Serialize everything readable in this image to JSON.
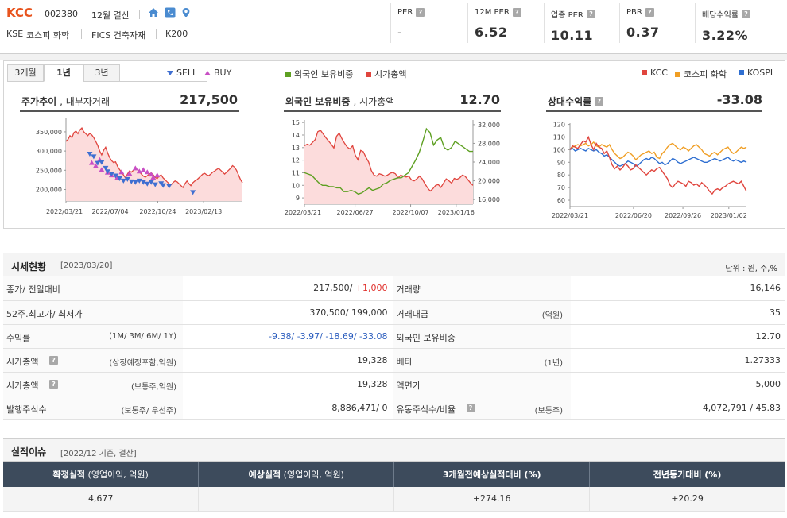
{
  "header": {
    "name": "KCC",
    "code": "002380",
    "settlement": "12월 결산",
    "market": "KSE",
    "sector_kospi": "코스피 화학",
    "sector_fics": "FICS 건축자재",
    "index": "K200",
    "metrics": [
      {
        "label": "PER",
        "value": "-"
      },
      {
        "label": "12M PER",
        "value": "6.52"
      },
      {
        "label": "업종 PER",
        "value": "10.11"
      },
      {
        "label": "PBR",
        "value": "0.37"
      },
      {
        "label": "배당수익률",
        "value": "3.22%"
      }
    ]
  },
  "charts": {
    "tabs": [
      "3개월",
      "1년",
      "3년"
    ],
    "active_tab": "1년",
    "legend_trades": [
      "SELL",
      "BUY"
    ],
    "legend_foreign": [
      "외국인 보유비중",
      "시가총액"
    ],
    "legend_relative": [
      "KCC",
      "코스피 화학",
      "KOSPI"
    ],
    "price": {
      "title_bold": "주가추이",
      "title_rest": ", 내부자거래",
      "value": "217,500"
    },
    "foreign": {
      "title_bold": "외국인 보유비중",
      "title_rest": ", 시가총액",
      "value": "12.70"
    },
    "relative": {
      "title_bold": "상대수익률",
      "title_rest": "",
      "value": "-33.08"
    }
  },
  "chart_data": [
    {
      "type": "area",
      "title": "주가추이, 내부자거래",
      "x_ticks": [
        "2022/03/21",
        "2022/07/04",
        "2022/10/24",
        "2023/02/13"
      ],
      "y_ticks": [
        "350,000",
        "300,000",
        "250,000",
        "200,000"
      ],
      "ylim": [
        170000,
        385000
      ],
      "series": [
        {
          "name": "주가",
          "color": "#e0453e",
          "values": [
            325000,
            330000,
            340000,
            335000,
            348000,
            352000,
            345000,
            355000,
            360000,
            350000,
            345000,
            340000,
            346000,
            342000,
            335000,
            325000,
            315000,
            300000,
            290000,
            302000,
            310000,
            295000,
            283000,
            275000,
            270000,
            272000,
            260000,
            252000,
            245000,
            238000,
            230000,
            240000,
            248000,
            245000,
            250000,
            255000,
            252000,
            246000,
            240000,
            235000,
            232000,
            236000,
            240000,
            243000,
            238000,
            232000,
            228000,
            235000,
            238000,
            230000,
            225000,
            220000,
            215000,
            212000,
            218000,
            222000,
            220000,
            215000,
            210000,
            205000,
            215000,
            222000,
            215000,
            210000,
            217500,
            222000,
            225000,
            230000,
            235000,
            240000,
            242000,
            238000,
            236000,
            240000,
            245000,
            248000,
            252000,
            255000,
            250000,
            245000,
            240000,
            245000,
            250000,
            255000,
            262000,
            258000,
            250000,
            238000,
            226000,
            217500
          ]
        }
      ],
      "buy_marks": [
        [
          13,
          270000
        ],
        [
          15,
          262000
        ],
        [
          17,
          278000
        ],
        [
          18,
          252000
        ],
        [
          21,
          245000
        ],
        [
          23,
          238000
        ],
        [
          26,
          232000
        ],
        [
          28,
          246000
        ],
        [
          32,
          242000
        ],
        [
          35,
          256000
        ],
        [
          37,
          248000
        ],
        [
          39,
          252000
        ],
        [
          41,
          246000
        ],
        [
          43,
          240000
        ],
        [
          44,
          232000
        ],
        [
          46,
          238000
        ]
      ],
      "sell_marks": [
        [
          12,
          292000
        ],
        [
          14,
          285000
        ],
        [
          16,
          268000
        ],
        [
          18,
          270000
        ],
        [
          20,
          255000
        ],
        [
          21,
          246000
        ],
        [
          23,
          240000
        ],
        [
          25,
          235000
        ],
        [
          27,
          228000
        ],
        [
          29,
          222000
        ],
        [
          31,
          226000
        ],
        [
          33,
          220000
        ],
        [
          35,
          218000
        ],
        [
          37,
          222000
        ],
        [
          39,
          218000
        ],
        [
          41,
          214000
        ],
        [
          43,
          218000
        ],
        [
          45,
          212000
        ],
        [
          48,
          215000
        ],
        [
          49,
          210000
        ],
        [
          52,
          208000
        ],
        [
          64,
          192000
        ]
      ]
    },
    {
      "type": "line",
      "title": "외국인 보유비중, 시가총액",
      "x_ticks": [
        "2022/03/21",
        "2022/06/27",
        "2022/10/07",
        "2023/01/16"
      ],
      "y_left_ticks": [
        "15",
        "14",
        "13",
        "12",
        "11",
        "10",
        "9"
      ],
      "y_right_ticks": [
        "32,000",
        "28,000",
        "24,000",
        "20,000",
        "16,000"
      ],
      "ylim_left": [
        8.5,
        15.2
      ],
      "ylim_right": [
        15000,
        33000
      ],
      "series": [
        {
          "name": "외국인 보유비중",
          "color": "#5ea022",
          "axis": "left",
          "values": [
            11.0,
            10.9,
            10.8,
            10.5,
            10.2,
            10.0,
            10.0,
            9.9,
            9.9,
            9.8,
            9.8,
            9.5,
            9.5,
            9.6,
            9.5,
            9.3,
            9.4,
            9.6,
            9.8,
            9.6,
            9.7,
            9.8,
            10.1,
            10.2,
            10.4,
            10.5,
            10.6,
            10.6,
            10.8,
            11.0,
            11.5,
            12.0,
            12.6,
            13.5,
            14.5,
            14.2,
            13.2,
            13.6,
            13.8,
            13.0,
            12.8,
            13.0,
            13.5,
            13.3,
            13.1,
            12.9,
            12.7,
            12.7
          ]
        },
        {
          "name": "시가총액",
          "color": "#e0453e",
          "axis": "right",
          "values": [
            27500,
            27800,
            27600,
            28200,
            28800,
            30500,
            30800,
            30000,
            29200,
            28500,
            27800,
            27000,
            29500,
            30200,
            29000,
            28000,
            27200,
            26800,
            27500,
            25500,
            24500,
            26500,
            26200,
            25000,
            24000,
            22200,
            21200,
            21000,
            21500,
            21300,
            21000,
            21200,
            21600,
            21800,
            21500,
            20600,
            21200,
            21000,
            20800,
            21000,
            20200,
            20000,
            20400,
            21000,
            20400,
            19400,
            18500,
            17800,
            18300,
            19000,
            19200,
            18600,
            19500,
            20400,
            20000,
            19500,
            20500,
            20300,
            20600,
            21200,
            21000,
            20300,
            19600,
            19000
          ]
        }
      ]
    },
    {
      "type": "line",
      "title": "상대수익률",
      "x_ticks": [
        "2022/03/21",
        "2022/06/20",
        "2022/09/26",
        "2023/01/02"
      ],
      "y_ticks": [
        "120",
        "110",
        "100",
        "90",
        "80",
        "70",
        "60"
      ],
      "ylim": [
        55,
        121
      ],
      "series": [
        {
          "name": "코스피 화학",
          "color": "#f09e24",
          "values": [
            100,
            102,
            103,
            104,
            103,
            104,
            105,
            103,
            104,
            106,
            103,
            102,
            104,
            103,
            102,
            104,
            100,
            97,
            95,
            93,
            94,
            96,
            98,
            97,
            95,
            92,
            94,
            96,
            97,
            98,
            99,
            97,
            98,
            94,
            93,
            97,
            99,
            102,
            104,
            105,
            103,
            101,
            100,
            102,
            101,
            99,
            101,
            103,
            104,
            102,
            100,
            97,
            96,
            95,
            97,
            98,
            96,
            98,
            100,
            101,
            102,
            99,
            97,
            98,
            100,
            102,
            101,
            102
          ]
        },
        {
          "name": "KOSPI",
          "color": "#2f6fd1",
          "values": [
            100,
            101,
            99,
            100,
            101,
            100,
            99,
            101,
            100,
            99,
            100,
            98,
            97,
            95,
            96,
            94,
            92,
            90,
            88,
            87,
            88,
            89,
            91,
            90,
            89,
            87,
            88,
            90,
            92,
            93,
            92,
            94,
            93,
            91,
            89,
            90,
            88,
            89,
            91,
            93,
            92,
            90,
            89,
            90,
            91,
            92,
            93,
            94,
            93,
            92,
            91,
            90,
            90,
            91,
            92,
            93,
            92,
            91,
            92,
            93,
            94,
            92,
            91,
            92,
            91,
            90,
            91,
            90
          ]
        },
        {
          "name": "KCC",
          "color": "#e0453e",
          "values": [
            100,
            103,
            102,
            101,
            104,
            107,
            106,
            110,
            104,
            100,
            105,
            102,
            101,
            97,
            99,
            94,
            88,
            85,
            87,
            84,
            86,
            89,
            87,
            84,
            85,
            88,
            86,
            84,
            82,
            80,
            82,
            84,
            83,
            85,
            86,
            83,
            80,
            77,
            72,
            70,
            73,
            75,
            74,
            73,
            71,
            75,
            74,
            72,
            73,
            71,
            74,
            72,
            70,
            67,
            65,
            68,
            69,
            68,
            70,
            71,
            73,
            74,
            75,
            74,
            73,
            75,
            71,
            67
          ]
        }
      ]
    }
  ],
  "market_table": {
    "title": "시세현황",
    "date": "[2023/03/20]",
    "unit": "단위 : 원, 주,%",
    "rows": [
      {
        "k1": "종가/ 전일대비",
        "s1": "",
        "v1a": "217,500/ ",
        "v1b": "+1,000",
        "k2": "거래량",
        "s2": "",
        "v2": "16,146"
      },
      {
        "k1": "52주.최고가/ 최저가",
        "s1": "",
        "v1a": "370,500/ 199,000",
        "v1b": "",
        "k2": "거래대금",
        "s2": "(억원)",
        "v2": "35"
      },
      {
        "k1": "수익률",
        "s1": "(1M/ 3M/ 6M/ 1Y)",
        "v1a": "",
        "v1b": "-9.38/ -3.97/ -18.69/ -33.08",
        "k2": "외국인 보유비중",
        "s2": "",
        "v2": "12.70"
      },
      {
        "k1": "시가총액",
        "s1": "(상장예정포함,억원)",
        "v1a": "19,328",
        "v1b": "",
        "k2": "베타",
        "s2": "(1년)",
        "v2": "1.27333"
      },
      {
        "k1": "시가총액",
        "s1": "(보통주,억원)",
        "v1a": "19,328",
        "v1b": "",
        "k2": "액면가",
        "s2": "",
        "v2": "5,000"
      },
      {
        "k1": "발행주식수",
        "s1": "(보통주/ 우선주)",
        "v1a": "8,886,471/ 0",
        "v1b": "",
        "k2": "유동주식수/비율",
        "s2": "(보통주)",
        "v2": "4,072,791 / 45.83"
      }
    ]
  },
  "perf_table": {
    "title": "실적이슈",
    "date": "[2022/12 기준, 결산]",
    "headers": [
      {
        "bold": "확정실적",
        "rest": " (영업이익, 억원)"
      },
      {
        "bold": "예상실적",
        "rest": " (영업이익, 억원)"
      },
      {
        "bold": "3개월전예상실적대비 (%)",
        "rest": ""
      },
      {
        "bold": "전년동기대비 (%)",
        "rest": ""
      }
    ],
    "row": [
      "4,677",
      "",
      "+274.16",
      "+20.29"
    ]
  },
  "colors": {
    "brand": "#e8541e",
    "up": "#e0312d",
    "down": "#2e5fbf",
    "header_dark": "#3d4b5c"
  }
}
